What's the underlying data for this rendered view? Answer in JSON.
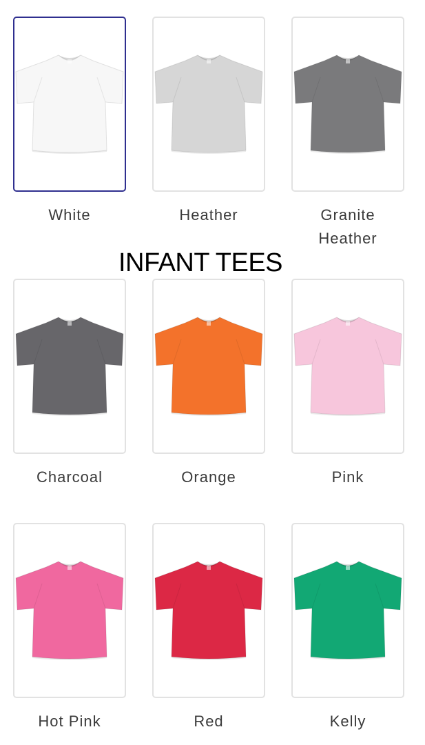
{
  "section": {
    "title": "INFANT TEES"
  },
  "selected_index": 0,
  "swatches": [
    {
      "label": "White",
      "color": "#f7f7f7",
      "icon": "white-tshirt-icon"
    },
    {
      "label": "Heather",
      "color": "#d6d6d6",
      "icon": "heather-tshirt-icon"
    },
    {
      "label": "Granite\nHeather",
      "color": "#7a7a7c",
      "icon": "granite-heather-tshirt-icon"
    },
    {
      "label": "Charcoal",
      "color": "#67666a",
      "icon": "charcoal-tshirt-icon"
    },
    {
      "label": "Orange",
      "color": "#f3722b",
      "icon": "orange-tshirt-icon"
    },
    {
      "label": "Pink",
      "color": "#f7c6dc",
      "icon": "pink-tshirt-icon"
    },
    {
      "label": "Hot Pink",
      "color": "#f0689f",
      "icon": "hot-pink-tshirt-icon"
    },
    {
      "label": "Red",
      "color": "#dc2845",
      "icon": "red-tshirt-icon"
    },
    {
      "label": "Kelly",
      "color": "#12a874",
      "icon": "kelly-tshirt-icon"
    }
  ]
}
